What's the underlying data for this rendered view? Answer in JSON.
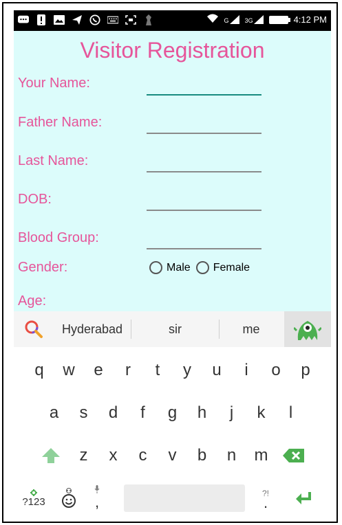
{
  "status_bar": {
    "time": "4:12 PM",
    "network_3g": "3G",
    "network_g": "G"
  },
  "form": {
    "title": "Visitor Registration",
    "labels": {
      "your_name": "Your Name:",
      "father_name": "Father Name:",
      "last_name": "Last Name:",
      "dob": "DOB:",
      "blood_group": "Blood Group:",
      "gender": "Gender:",
      "age": "Age:"
    },
    "gender_options": [
      "Male",
      "Female"
    ]
  },
  "keyboard": {
    "suggestions": [
      "Hyderabad",
      "sir",
      "me"
    ],
    "row1": [
      "q",
      "w",
      "e",
      "r",
      "t",
      "y",
      "u",
      "i",
      "o",
      "p"
    ],
    "row2": [
      "a",
      "s",
      "d",
      "f",
      "g",
      "h",
      "j",
      "k",
      "l"
    ],
    "row3": [
      "z",
      "x",
      "c",
      "v",
      "b",
      "n",
      "m"
    ],
    "symbols_key": "?123",
    "comma_key": ",",
    "period_hint": "?!",
    "period_key": "."
  },
  "colors": {
    "accent_pink": "#e6559a",
    "form_bg": "#dcfcfb",
    "active_underline": "#178a7f",
    "keyboard_green": "#4caf50"
  }
}
